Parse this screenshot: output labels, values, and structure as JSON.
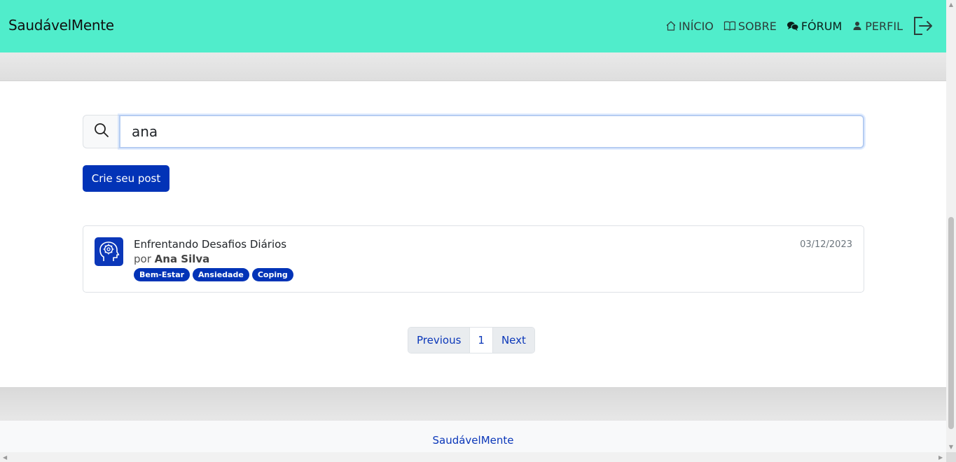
{
  "navbar": {
    "brand": "SaudávelMente",
    "items": [
      {
        "label": "INÍCIO",
        "icon": "house-icon"
      },
      {
        "label": "SOBRE",
        "icon": "book-icon"
      },
      {
        "label": "FÓRUM",
        "icon": "chat-bubbles-icon",
        "active": true
      },
      {
        "label": "PERFIL",
        "icon": "person-icon"
      }
    ],
    "logout_icon": "logout-icon",
    "background": "#50edcb"
  },
  "search": {
    "value": "ana",
    "icon": "search-icon"
  },
  "create_post": {
    "label": "Crie seu post",
    "color": "#0233b7"
  },
  "posts": [
    {
      "title": "Enfrentando Desafios Diários",
      "author_prefix": "por",
      "author": "Ana Silva",
      "date": "03/12/2023",
      "avatar_icon": "brain-head-icon",
      "tags": [
        "Bem-Estar",
        "Ansiedade",
        "Coping"
      ]
    }
  ],
  "pagination": {
    "previous": "Previous",
    "current": "1",
    "next": "Next"
  },
  "footer": {
    "link": "SaudávelMente"
  }
}
